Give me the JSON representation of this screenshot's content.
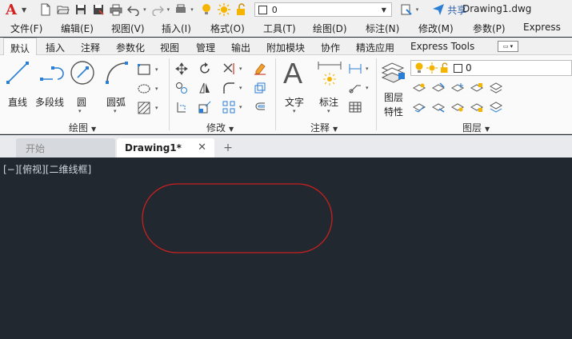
{
  "app": {
    "logo": "A",
    "document_title": "Drawing1.dwg"
  },
  "quick_access": {
    "layer_value": "0",
    "share_label": "共享"
  },
  "menu": [
    "文件(F)",
    "编辑(E)",
    "视图(V)",
    "插入(I)",
    "格式(O)",
    "工具(T)",
    "绘图(D)",
    "标注(N)",
    "修改(M)",
    "参数(P)",
    "Express"
  ],
  "ribbon_tabs": [
    "默认",
    "插入",
    "注释",
    "参数化",
    "视图",
    "管理",
    "输出",
    "附加模块",
    "协作",
    "精选应用",
    "Express Tools"
  ],
  "active_ribbon_tab": "默认",
  "panels": {
    "draw": {
      "title": "绘图",
      "line": "直线",
      "polyline": "多段线",
      "circle": "圆",
      "arc": "圆弧"
    },
    "modify": {
      "title": "修改"
    },
    "annotation": {
      "title": "注释",
      "text": "文字",
      "dimension": "标注"
    },
    "layers": {
      "title": "图层",
      "properties_line1": "图层",
      "properties_line2": "特性",
      "current_layer": "0"
    }
  },
  "file_tabs": {
    "start": "开始",
    "current": "Drawing1*",
    "close_glyph": "✕",
    "add_glyph": "+"
  },
  "viewport": {
    "controls": "[−][俯视][二维线框]"
  },
  "colors": {
    "canvas": "#212830",
    "shape_stroke": "#c8201f",
    "accent_blue": "#2a7fd4",
    "logo_red": "#d21f1f"
  }
}
